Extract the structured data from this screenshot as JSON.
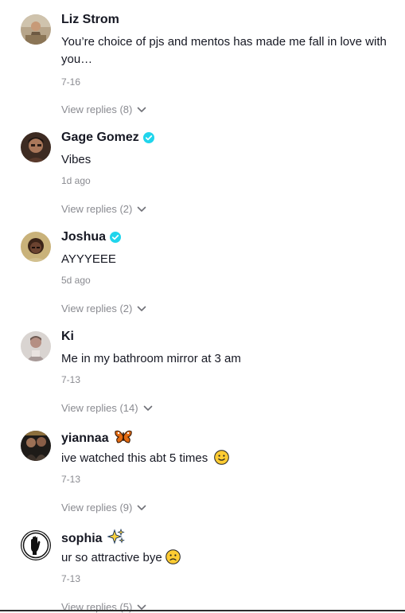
{
  "comments": [
    {
      "username": "Liz Strom",
      "verified": false,
      "text": "You’re choice of pjs and mentos has made me fall in love with you…",
      "date": "7-16",
      "replies": "View replies (8)"
    },
    {
      "username": "Gage Gomez",
      "verified": true,
      "text": "Vibes",
      "date": "1d ago",
      "replies": "View replies (2)"
    },
    {
      "username": "Joshua",
      "verified": true,
      "text": "AYYYEEE",
      "date": "5d ago",
      "replies": "View replies (2)"
    },
    {
      "username": "Ki",
      "verified": false,
      "text": "Me in my bathroom mirror at 3 am",
      "date": "7-13",
      "replies": "View replies (14)"
    },
    {
      "username": "yiannaa",
      "verified": false,
      "text": "ive watched this abt 5 times",
      "date": "7-13",
      "replies": "View replies (9)"
    },
    {
      "username": "sophia",
      "verified": false,
      "text": "ur so attractive bye",
      "date": "7-13",
      "replies": "View replies (5)"
    }
  ],
  "colors": {
    "text": "#161823",
    "muted": "#8a8b91",
    "verified": "#20d5ec"
  },
  "icons": {
    "verified": "verified-badge-icon",
    "chevron": "chevron-down-icon",
    "butterfly": "butterfly-emoji-icon",
    "sparkles": "sparkles-emoji-icon",
    "smile": "slightly-smiling-face-icon",
    "frown": "slightly-frowning-face-icon"
  }
}
